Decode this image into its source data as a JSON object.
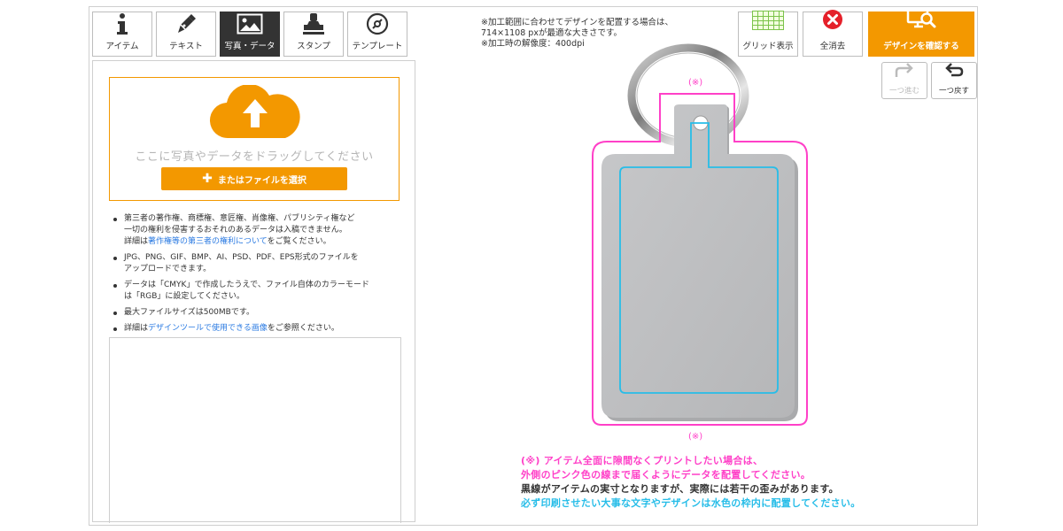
{
  "tabs": [
    {
      "label": "アイテム",
      "icon": "info-icon",
      "active": false
    },
    {
      "label": "テキスト",
      "icon": "pen-icon",
      "active": false
    },
    {
      "label": "写真・データ",
      "icon": "image-icon",
      "active": true
    },
    {
      "label": "スタンプ",
      "icon": "stamp-icon",
      "active": false
    },
    {
      "label": "テンプレート",
      "icon": "template-icon",
      "active": false
    }
  ],
  "upload": {
    "drop_text": "ここに写真やデータをドラッグしてください",
    "file_button": "またはファイルを選択",
    "cloud_icon": "cloud-upload-icon"
  },
  "notes": {
    "item1": {
      "line1": "第三者の著作権、商標権、意匠権、肖像権、パブリシティ権など",
      "line2": "一切の権利を侵害するおそれのあるデータは入稿できません。",
      "line3_prefix": "詳細は",
      "line3_link": "著作権等の第三者の権利について",
      "line3_suffix": "をご覧ください。"
    },
    "item2": {
      "line1": "JPG、PNG、GIF、BMP、AI、PSD、PDF、EPS形式のファイルを",
      "line2": "アップロードできます。"
    },
    "item3": {
      "line1": "データは「CMYK」で作成したうえで、ファイル自体のカラーモード",
      "line2": "は「RGB」に設定してください。"
    },
    "item4": {
      "line1": "最大ファイルサイズは500MBです。"
    },
    "item5": {
      "prefix": "詳細は",
      "link": "デザインツールで使用できる画像",
      "suffix": "をご参照ください。"
    }
  },
  "top_notes": {
    "line1": "※加工範囲に合わせてデザインを配置する場合は、",
    "line2": "714×1108 pxが最適な大きさです。",
    "line3": "※加工時の解像度：400dpi"
  },
  "toolbar": {
    "grid_label": "グリッド表示",
    "clear_label": "全消去",
    "confirm_label": "デザインを確認する",
    "redo_label": "一つ進む",
    "undo_label": "一つ戻す"
  },
  "canvas": {
    "mark_top": "(※)",
    "mark_bottom": "(※)"
  },
  "bottom_notes": {
    "pink1": "(※) アイテム全面に隙間なくプリントしたい場合は、",
    "pink2": "外側のピンク色の線まで届くようにデータを配置してください。",
    "dark": "黒線がアイテムの実寸となりますが、実際には若干の歪みがあります。",
    "cyan": "必ず印刷させたい大事な文字やデザインは水色の枠内に配置してください。"
  },
  "colors": {
    "accent": "#f39800",
    "pink_line": "#ff40c8",
    "cyan_line": "#27bde8",
    "active_tab": "#333333",
    "link": "#2a7ae2"
  }
}
